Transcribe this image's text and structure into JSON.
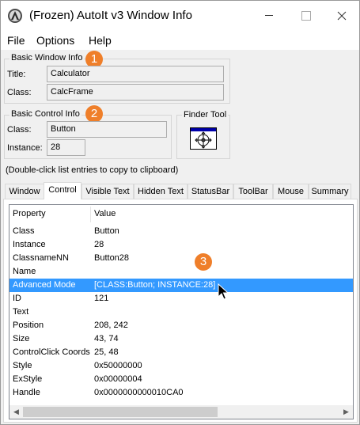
{
  "window": {
    "title": "(Frozen) AutoIt v3 Window Info",
    "app_icon": "autoit-icon",
    "controls": [
      "minimize-icon",
      "maximize-icon",
      "close-icon"
    ]
  },
  "menu": {
    "file": "File",
    "options": "Options",
    "help": "Help"
  },
  "basic_window": {
    "group_title": "Basic Window Info",
    "title_label": "Title:",
    "title_value": "Calculator",
    "class_label": "Class:",
    "class_value": "CalcFrame"
  },
  "basic_control": {
    "group_title": "Basic Control Info",
    "class_label": "Class:",
    "class_value": "Button",
    "instance_label": "Instance:",
    "instance_value": "28"
  },
  "finder": {
    "group_title": "Finder Tool",
    "icon": "crosshair-finder-icon"
  },
  "badges": [
    "1",
    "2",
    "3"
  ],
  "hint": "(Double-click list entries to copy to clipboard)",
  "tabs": [
    "Window",
    "Control",
    "Visible Text",
    "Hidden Text",
    "StatusBar",
    "ToolBar",
    "Mouse",
    "Summary"
  ],
  "active_tab": "Control",
  "list": {
    "headers": [
      "Property",
      "Value"
    ],
    "rows": [
      {
        "property": "Class",
        "value": "Button"
      },
      {
        "property": "Instance",
        "value": "28"
      },
      {
        "property": "ClassnameNN",
        "value": "Button28"
      },
      {
        "property": "Name",
        "value": ""
      },
      {
        "property": "Advanced Mode",
        "value": "[CLASS:Button; INSTANCE:28]"
      },
      {
        "property": "ID",
        "value": "121"
      },
      {
        "property": "Text",
        "value": ""
      },
      {
        "property": "Position",
        "value": "208, 242"
      },
      {
        "property": "Size",
        "value": "43, 74"
      },
      {
        "property": "ControlClick Coords",
        "value": "25, 48"
      },
      {
        "property": "Style",
        "value": "0x50000000"
      },
      {
        "property": "ExStyle",
        "value": "0x00000004"
      },
      {
        "property": "Handle",
        "value": "0x0000000000010CA0"
      }
    ],
    "selected_row": "Advanced Mode"
  },
  "colors": {
    "selection": "#3399ff",
    "badge": "#ef7f2a"
  }
}
